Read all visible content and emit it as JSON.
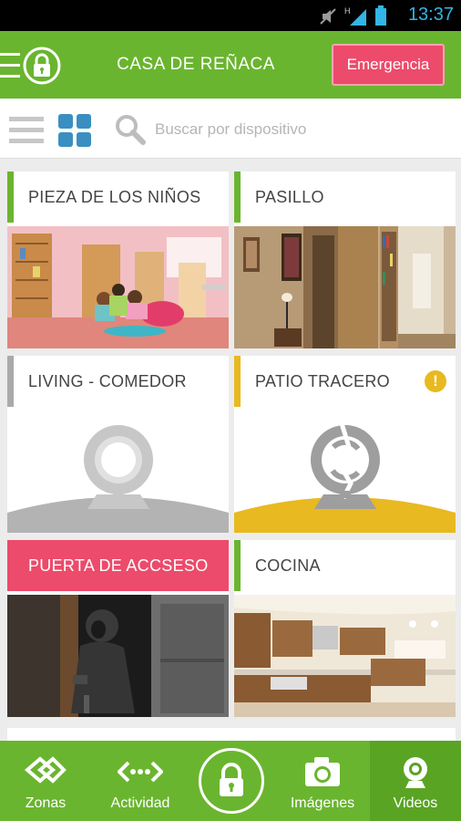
{
  "status_bar": {
    "time": "13:37"
  },
  "app_bar": {
    "title": "CASA DE REÑACA",
    "emergency_label": "Emergencia"
  },
  "toolbar": {
    "search_placeholder": "Buscar por dispositivo"
  },
  "devices": [
    {
      "label": "PIEZA DE LOS NIÑOS",
      "state": "ok",
      "preview": "photo-kids-room"
    },
    {
      "label": "PASILLO",
      "state": "ok",
      "preview": "photo-hallway"
    },
    {
      "label": "LIVING - COMEDOR",
      "state": "offline",
      "preview": "camera-offline"
    },
    {
      "label": "PATIO TRACERO",
      "state": "warning",
      "preview": "camera-broken"
    },
    {
      "label": "PUERTA DE ACCSESO",
      "state": "alarm",
      "preview": "photo-intruder"
    },
    {
      "label": "COCINA",
      "state": "ok",
      "preview": "photo-kitchen"
    }
  ],
  "bottom_nav": {
    "items": [
      {
        "label": "Zonas",
        "icon": "zones-icon"
      },
      {
        "label": "Actividad",
        "icon": "activity-icon"
      },
      {
        "label": "Imágenes",
        "icon": "camera-icon"
      },
      {
        "label": "Videos",
        "icon": "webcam-icon",
        "active": true
      }
    ]
  },
  "colors": {
    "brand_green": "#6ab52f",
    "alarm_pink": "#ec4b6b",
    "warning_yellow": "#e8b920",
    "offline_gray": "#aaaaaa",
    "accent_blue": "#3a8fc1"
  }
}
